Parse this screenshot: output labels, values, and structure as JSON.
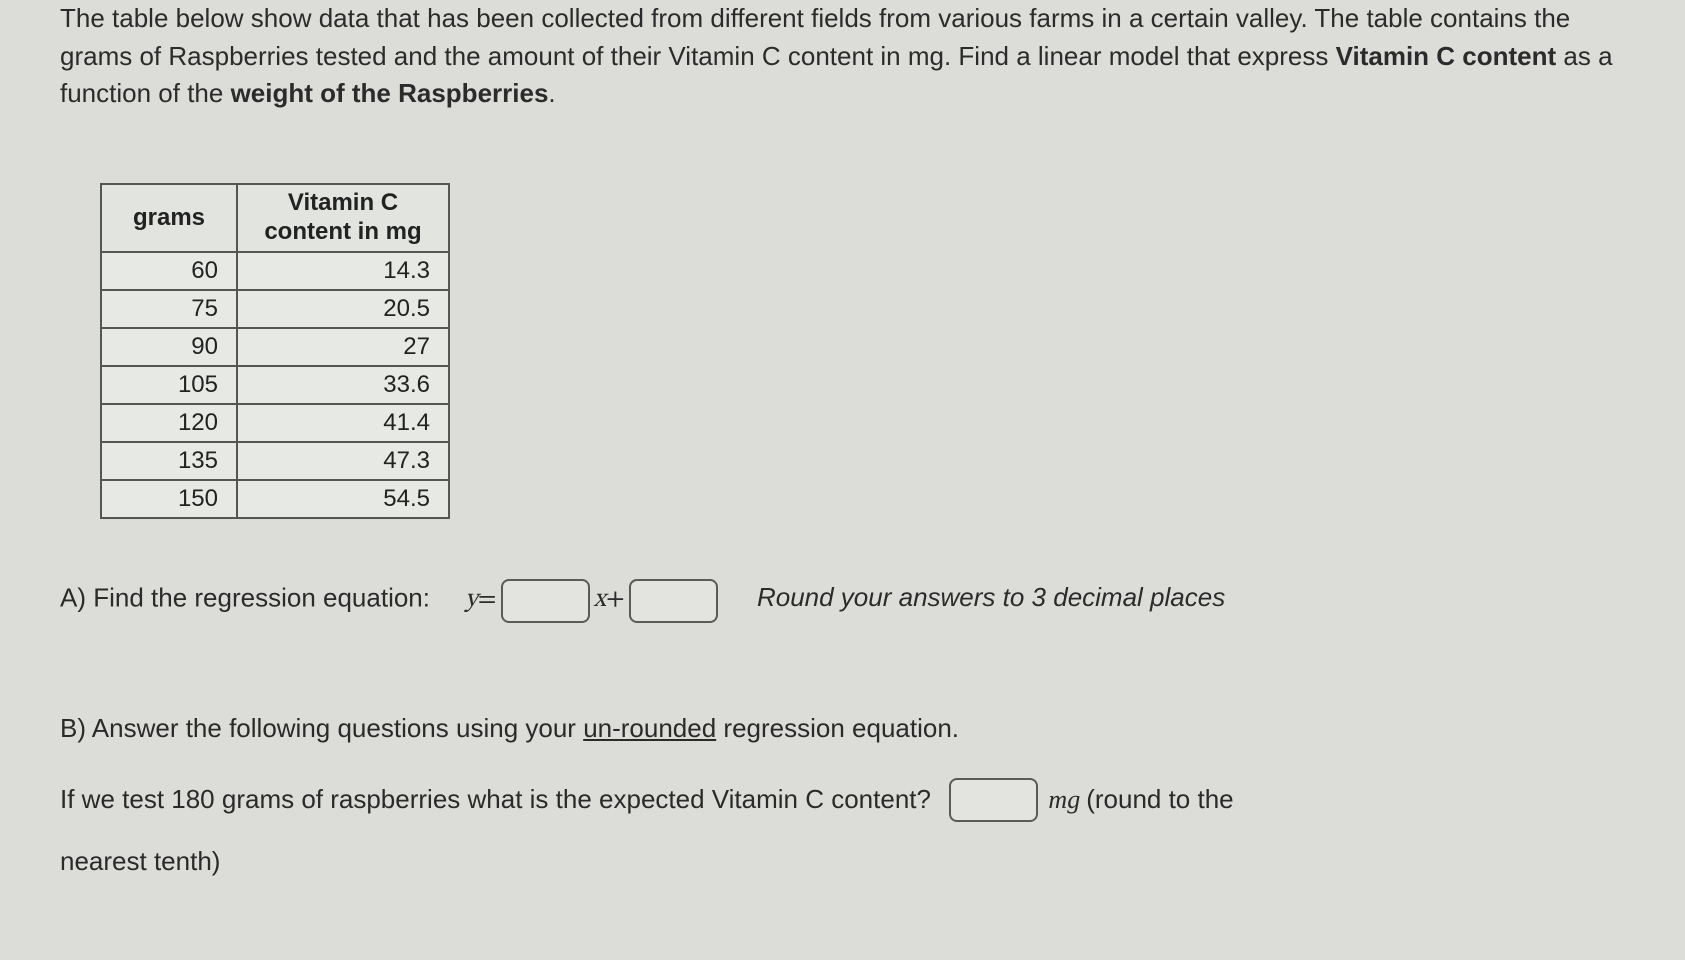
{
  "intro": {
    "text_pre": "The table below show data that has been collected from different fields from various farms in a certain valley. The table contains the grams of Raspberries tested and the amount of their Vitamin C content in mg. Find a linear model that express ",
    "bold1": "Vitamin C content",
    "text_mid": " as a function of the ",
    "bold2": "weight of the Raspberries",
    "text_post": "."
  },
  "table": {
    "header_grams": "grams",
    "header_vitc_line1": "Vitamin C",
    "header_vitc_line2": "content in mg",
    "rows": [
      {
        "grams": "60",
        "vitc": "14.3"
      },
      {
        "grams": "75",
        "vitc": "20.5"
      },
      {
        "grams": "90",
        "vitc": "27"
      },
      {
        "grams": "105",
        "vitc": "33.6"
      },
      {
        "grams": "120",
        "vitc": "41.4"
      },
      {
        "grams": "135",
        "vitc": "47.3"
      },
      {
        "grams": "150",
        "vitc": "54.5"
      }
    ]
  },
  "partA": {
    "label": "A)  Find the regression equation:",
    "y": "y",
    "equals": " = ",
    "x": "x",
    "plus": "+",
    "hint": "Round your answers to 3 decimal places"
  },
  "partB": {
    "label_pre": "B)  Answer the following questions using your ",
    "label_underlined": "un-rounded",
    "label_post": " regression equation.",
    "q_pre": "If we test 180 grams of raspberries what is the expected Vitamin C content?",
    "unit": "mg",
    "q_post1": " (round to the",
    "q_post2": "nearest tenth)"
  },
  "chart_data": {
    "type": "table",
    "columns": [
      "grams",
      "Vitamin C content in mg"
    ],
    "rows": [
      [
        60,
        14.3
      ],
      [
        75,
        20.5
      ],
      [
        90,
        27
      ],
      [
        105,
        33.6
      ],
      [
        120,
        41.4
      ],
      [
        135,
        47.3
      ],
      [
        150,
        54.5
      ]
    ]
  }
}
